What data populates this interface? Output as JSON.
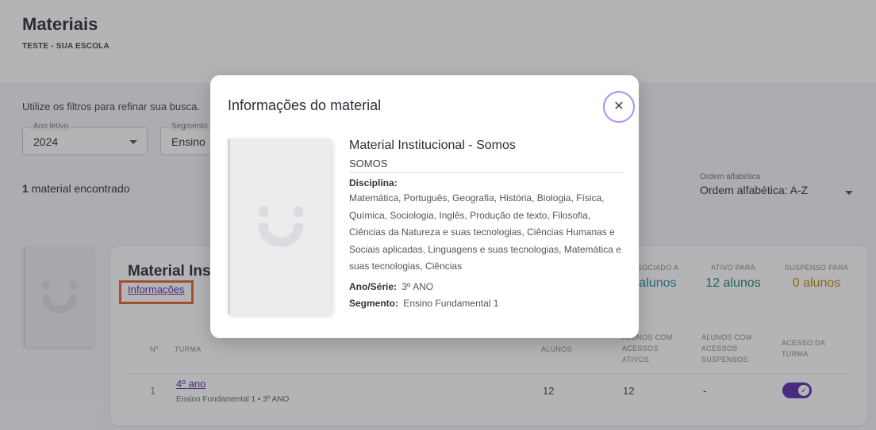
{
  "page": {
    "title": "Materiais",
    "subtitle": "TESTE - SUA ESCOLA"
  },
  "filters": {
    "hint": "Utilize os filtros para refinar sua busca.",
    "year": {
      "label": "Ano letivo",
      "value": "2024"
    },
    "segment": {
      "label": "Segmento",
      "value": "Ensino"
    }
  },
  "results": {
    "count": "1",
    "label": "material encontrado"
  },
  "order": {
    "label": "Ordem alfabética",
    "value": "Ordem alfabética: A-Z"
  },
  "card": {
    "title": "Material Inst",
    "info_link": "Informações",
    "stats": {
      "associated": {
        "label": "SOCIADO A",
        "value": "alunos"
      },
      "active": {
        "label": "ATIVO PARA",
        "value": "12 alunos"
      },
      "suspended": {
        "label": "SUSPENSO PARA",
        "value": "0 alunos"
      }
    },
    "table": {
      "headers": {
        "no": "Nº",
        "turma": "TURMA",
        "alunos": "ALUNOS",
        "ativos": "ALUNOS COM ACESSOS ATIVOS",
        "suspensos": "ALUNOS COM ACESSOS SUSPENSOS",
        "acesso": "ACESSO DA TURMA"
      },
      "rows": [
        {
          "no": "1",
          "turma": "4º ano",
          "turma_sub": "Ensino Fundamental 1 • 3º ANO",
          "alunos": "12",
          "ativos": "12",
          "suspensos": "-",
          "access_on": true
        }
      ]
    }
  },
  "modal": {
    "title": "Informações do material",
    "close_icon": "close-icon",
    "material_name": "Material Institucional - Somos",
    "publisher": "SOMOS",
    "discipline_label": "Disciplina:",
    "disciplines": "Matemática, Português, Geografia, História, Biologia, Física, Química, Sociologia, Inglês, Produção de texto, Filosofia, Ciências da Natureza e suas tecnologias, Ciências Humanas e Sociais aplicadas, Linguagens e suas tecnologias, Matemática e suas tecnologias, Ciências",
    "grade_label": "Ano/Série:",
    "grade": "3º ANO",
    "segment_label": "Segmento:",
    "segment": "Ensino Fundamental 1"
  },
  "colors": {
    "accent": "#5b2ca8",
    "highlight": "#e8632b",
    "close_ring": "#b28cf0",
    "associated": "#1c8aa8",
    "active": "#1d8b67",
    "suspended": "#c18d0a"
  }
}
